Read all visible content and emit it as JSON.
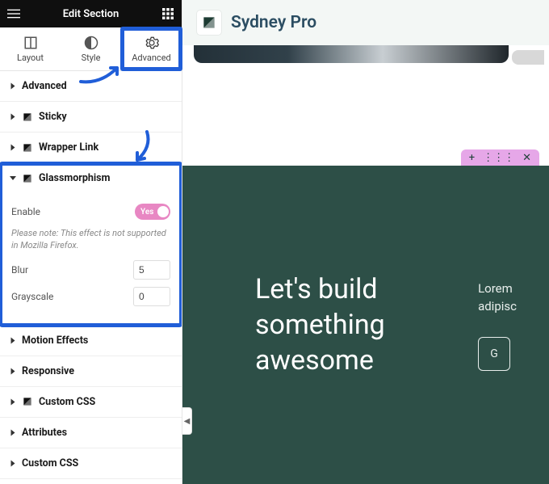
{
  "header": {
    "title": "Edit Section"
  },
  "tabs": [
    {
      "id": "layout",
      "label": "Layout"
    },
    {
      "id": "style",
      "label": "Style"
    },
    {
      "id": "advanced",
      "label": "Advanced",
      "active": true
    }
  ],
  "sections": {
    "advanced": "Advanced",
    "sticky": "Sticky",
    "wrapper_link": "Wrapper Link",
    "glassmorphism": {
      "title": "Glassmorphism",
      "enable_label": "Enable",
      "enable_value": "Yes",
      "note": "Please note: This effect is not supported in Mozilla Firefox.",
      "blur_label": "Blur",
      "blur_value": "5",
      "grayscale_label": "Grayscale",
      "grayscale_value": "0"
    },
    "motion_effects": "Motion Effects",
    "responsive": "Responsive",
    "custom_css_1": "Custom CSS",
    "attributes": "Attributes",
    "custom_css_2": "Custom CSS"
  },
  "preview": {
    "brand": "Sydney Pro",
    "hero_title": "Let's build something awesome",
    "hero_para": "Lorem adipisc",
    "hero_btn": "G"
  },
  "colors": {
    "highlight": "#205ed8",
    "hero_bg": "#2d4f47",
    "toggle_on": "#e887c3",
    "handle_bg": "#e6a7e8"
  }
}
